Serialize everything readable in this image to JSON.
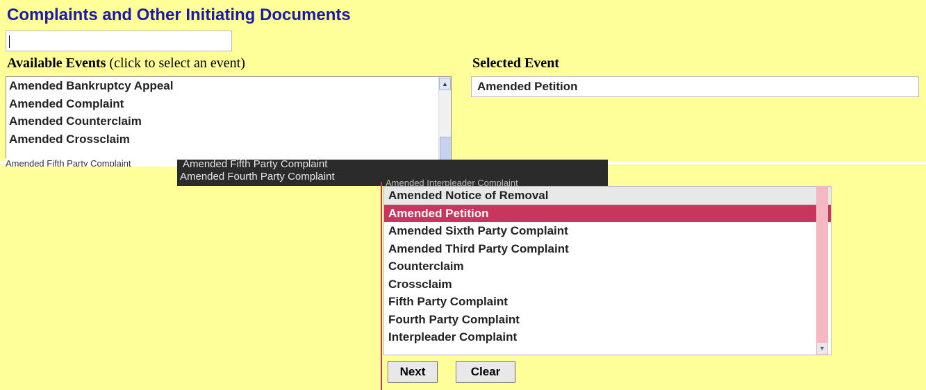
{
  "page": {
    "title": "Complaints and Other Initiating Documents",
    "available_label_bold": "Available Events",
    "available_label_hint": " (click to select an event)",
    "selected_label": "Selected Event"
  },
  "filter_input": {
    "value": ""
  },
  "available_events_top": [
    "Amended Bankruptcy Appeal",
    "Amended Complaint",
    "Amended Counterclaim",
    "Amended Crossclaim"
  ],
  "available_events_bottom": [
    "Amended Notice of Removal",
    "Amended Petition",
    "Amended Sixth Party Complaint",
    "Amended Third Party Complaint",
    "Counterclaim",
    "Crossclaim",
    "Fifth Party Complaint",
    "Fourth Party Complaint",
    "Interpleader Complaint"
  ],
  "garbled_rows": {
    "left": "Amended Fifth Party Complaint",
    "dark_line1": "Amended Fifth Party Complaint",
    "dark_line2": "Amended Fourth Party Complaint",
    "partial": "Amended Interpleader Complaint"
  },
  "selected_event": "Amended Petition",
  "buttons": {
    "next": "Next",
    "clear": "Clear"
  },
  "colors": {
    "background": "#ffff99",
    "title": "#1a1aa6",
    "selection": "#c8365e"
  }
}
